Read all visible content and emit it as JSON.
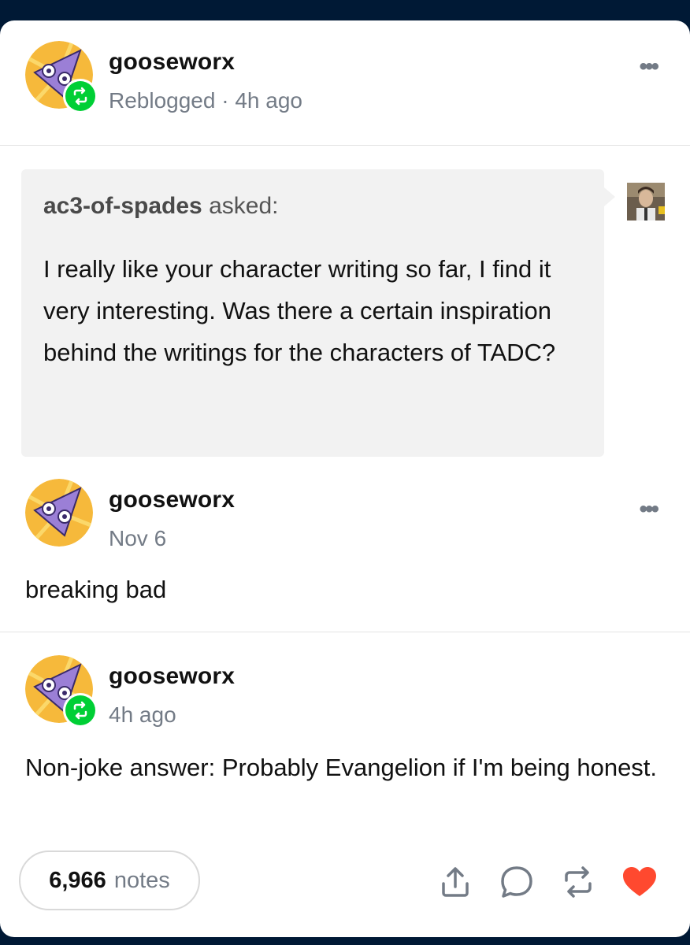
{
  "reblog_header": {
    "username": "gooseworx",
    "status": "Reblogged",
    "separator": "·",
    "time": "4h ago"
  },
  "ask": {
    "asker": "ac3-of-spades",
    "verb": "asked:",
    "question": "I really like your character writing so far, I find it very interesting. Was there a certain inspiration behind the writings for the characters of TADC?"
  },
  "original_post": {
    "username": "gooseworx",
    "date": "Nov 6",
    "body": "breaking bad"
  },
  "reblog_post": {
    "username": "gooseworx",
    "time": "4h ago",
    "body": "Non-joke answer: Probably Evangelion if I'm being honest."
  },
  "footer": {
    "notes_count": "6,966",
    "notes_label": "notes",
    "actions": [
      "share-icon",
      "reply-icon",
      "reblog-icon",
      "like-icon"
    ],
    "like_color": "#ff492f"
  },
  "colors": {
    "background": "#001935",
    "reblog_green": "#00cf35",
    "muted_text": "#737b86"
  }
}
